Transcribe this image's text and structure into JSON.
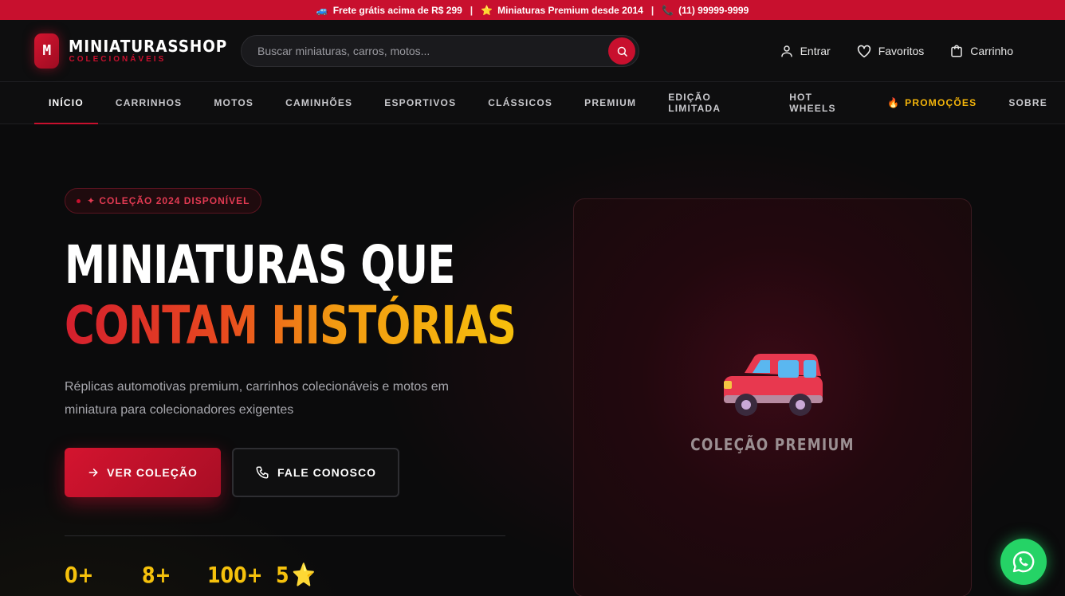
{
  "topbar": {
    "item1_icon": "car-icon",
    "item1": "Frete grátis acima de R$ 299",
    "sep": "|",
    "item2_icon": "star-icon",
    "item2": "Miniaturas Premium desde 2014",
    "item3_icon": "phone-icon",
    "item3": "(11) 99999-9999"
  },
  "brand": {
    "badge": "M",
    "name": "MINIATURASSHOP",
    "tagline": "COLECIONÁVEIS"
  },
  "search": {
    "placeholder": "Buscar miniaturas, carros, motos..."
  },
  "header_actions": {
    "login": "Entrar",
    "favorites": "Favoritos",
    "cart": "Carrinho"
  },
  "nav": {
    "items": [
      {
        "label": "INÍCIO"
      },
      {
        "label": "CARRINHOS"
      },
      {
        "label": "MOTOS"
      },
      {
        "label": "CAMINHÕES"
      },
      {
        "label": "ESPORTIVOS"
      },
      {
        "label": "CLÁSSICOS"
      },
      {
        "label": "PREMIUM"
      },
      {
        "label": "EDIÇÃO LIMITADA"
      },
      {
        "label": "HOT WHEELS"
      },
      {
        "label": "PROMOÇÕES"
      },
      {
        "label": "SOBRE"
      }
    ],
    "active": "INÍCIO"
  },
  "hero": {
    "pill": "✦ COLEÇÃO 2024 DISPONÍVEL",
    "headline_line1": "MINIATURAS QUE",
    "headline_line2": "CONTAM HISTÓRIAS",
    "lead": "Réplicas automotivas premium, carrinhos colecionáveis e motos em miniatura para colecionadores exigentes",
    "cta_primary": "VER COLEÇÃO",
    "cta_secondary": "FALE CONOSCO",
    "stats": [
      "0+",
      "8+",
      "100+",
      "5"
    ],
    "showcase_caption": "COLEÇÃO PREMIUM"
  },
  "colors": {
    "accent": "#c8102e",
    "gold": "#f5c10c",
    "whatsapp": "#25d366"
  }
}
